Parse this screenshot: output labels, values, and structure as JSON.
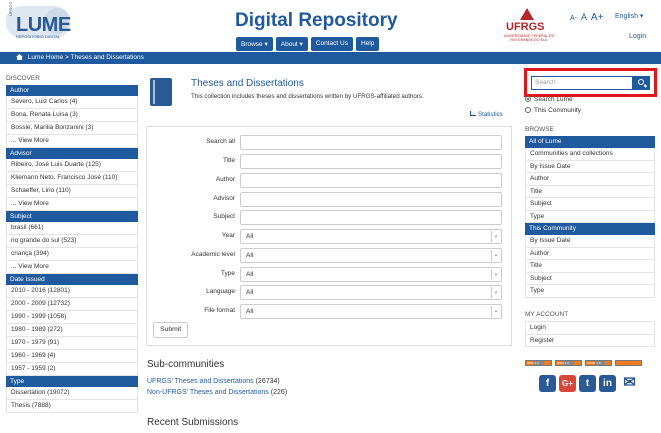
{
  "header": {
    "logo": "LUME",
    "logo_subtitle": "REPOSITÓRIO DIGITAL",
    "logo_small": "UFRGS",
    "site_title": "Digital Repository",
    "nav": [
      "Browse ▾",
      "About ▾",
      "Contact Us",
      "Help"
    ],
    "font_sizes": [
      "A-",
      "A",
      "A+"
    ],
    "language": "English ▾",
    "login": "Login",
    "ufrgs_name": "UFRGS",
    "ufrgs_full": "UNIVERSIDADE FEDERAL DO RIO GRANDE DO SUL"
  },
  "breadcrumb": [
    "Lume Home",
    ">",
    "Theses and Dissertations"
  ],
  "left_sidebar": {
    "title": "DISCOVER",
    "sections": [
      {
        "header": "Author",
        "items": [
          "Severo, Luiz Carlos (4)",
          "Bona, Renata Luisa (3)",
          "Bossle, Marilia Bonzanini (3)",
          "... View More"
        ]
      },
      {
        "header": "Advisor",
        "items": [
          "Ribeiro, José Luis Duarte (125)",
          "Kliemann Neto, Francisco José (110)",
          "Schaeffer, Lirio (110)",
          "... View More"
        ]
      },
      {
        "header": "Subject",
        "items": [
          "brasil (661)",
          "rio grande do sul (523)",
          "criança (394)",
          "... View More"
        ]
      },
      {
        "header": "Date Issued",
        "items": [
          "2010 - 2016 (12801)",
          "2000 - 2009 (12732)",
          "1990 - 1999 (1058)",
          "1980 - 1989 (272)",
          "1970 - 1979 (91)",
          "1960 - 1969 (4)",
          "1957 - 1959 (2)"
        ]
      },
      {
        "header": "Type",
        "items": [
          "Dissertation (19072)",
          "Thesis (7888)"
        ]
      }
    ]
  },
  "main": {
    "title": "Theses and Dissertations",
    "description": "This collection includes theses and dissertations written by UFRGS-affiliated authors.",
    "statistics": "Statistics",
    "form": {
      "text_fields": [
        "Search all",
        "Title",
        "Author",
        "Advisor",
        "Subject"
      ],
      "select_fields": [
        {
          "label": "Year",
          "value": "All"
        },
        {
          "label": "Academic level",
          "value": "All"
        },
        {
          "label": "Type",
          "value": "All"
        },
        {
          "label": "Language",
          "value": "All"
        },
        {
          "label": "File format",
          "value": "All"
        }
      ],
      "submit": "Submit"
    },
    "subcommunities_title": "Sub-communities",
    "subcommunities": [
      {
        "name": "UFRGS' Theses and Dissertations",
        "count": "(26734)"
      },
      {
        "name": "Non-UFRGS' Theses and Dissertations",
        "count": "(226)"
      }
    ],
    "recent_title": "Recent Submissions"
  },
  "right_sidebar": {
    "search_placeholder": "Search",
    "scope_options": [
      "Search Lume",
      "This Community"
    ],
    "browse_title": "BROWSE",
    "browse_all": {
      "header": "All of Lume",
      "items": [
        "Communities and collections",
        "By Issue Date",
        "Author",
        "Title",
        "Subject",
        "Type"
      ]
    },
    "browse_community": {
      "header": "This Community",
      "items": [
        "By Issue Date",
        "Author",
        "Title",
        "Subject",
        "Type"
      ]
    },
    "account_title": "MY ACCOUNT",
    "account_items": [
      "Login",
      "Register"
    ],
    "badges": [
      "W3C",
      "1.0",
      "W3C",
      "2.0",
      "ATOM",
      "1.0"
    ],
    "social_icons": [
      "facebook-icon",
      "google-plus-icon",
      "twitter-icon",
      "linkedin-icon",
      "mail-icon"
    ],
    "social_glyphs": [
      "f",
      "G+",
      "t",
      "in",
      "✉"
    ]
  }
}
